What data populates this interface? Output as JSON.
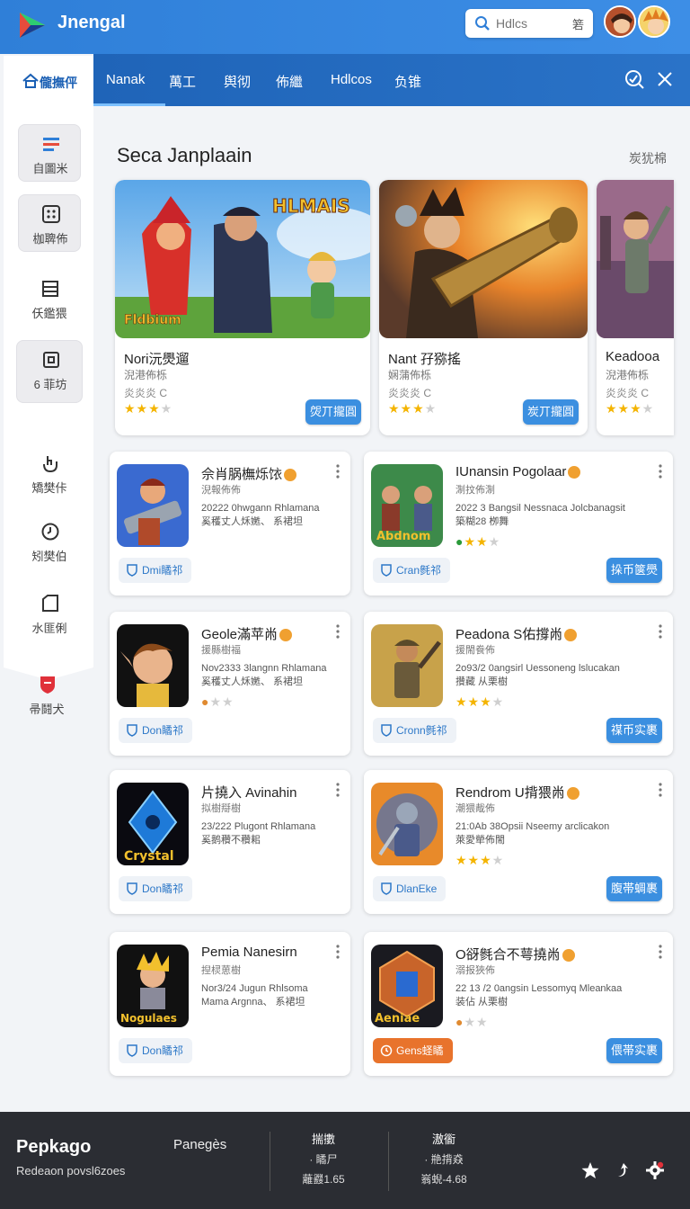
{
  "app": {
    "title": "Jnengal"
  },
  "search": {
    "placeholder": "Hdlcs",
    "right_glyph": "箬"
  },
  "tabs": [
    {
      "label": "Nanak"
    },
    {
      "label": "萬工"
    },
    {
      "label": "舆彻"
    },
    {
      "label": "佈繼"
    },
    {
      "label": "Hdlcos"
    },
    {
      "label": "负锥"
    }
  ],
  "sidebar": {
    "header": "儱撫伻",
    "items": [
      {
        "label": "自圖米",
        "icon": "app-grid-icon"
      },
      {
        "label": "枷聛佈",
        "icon": "dice-icon"
      },
      {
        "label": "仸鑑猥",
        "icon": "list-icon"
      },
      {
        "label": "6 菲坊",
        "icon": "box-icon"
      },
      {
        "label": "矯樊佧",
        "icon": "hand-icon"
      },
      {
        "label": "矧樊伯",
        "icon": "clock-icon"
      },
      {
        "label": "水匪俐",
        "icon": "square-icon"
      },
      {
        "label": "帚鬪犬",
        "icon": "shield-icon"
      }
    ]
  },
  "featured": {
    "title": "Seca Janplaain",
    "more_label": "炭犹棉",
    "cards": [
      {
        "name": "Nori沅爂遛",
        "sub": "淣港佈栎",
        "meta": "炎炎炎 C",
        "rating": 3,
        "button": "焈丌攏圓",
        "art_label": "HLMAIS",
        "art_sub": "Fldbium"
      },
      {
        "name": "Nant 孖猕搖",
        "sub": "娴蒲佈栎",
        "meta": "炎炎炎 C",
        "rating": 3,
        "button": "炭丌攏圓",
        "art_label": "",
        "art_sub": ""
      },
      {
        "name": "Keadooa",
        "sub": "淣港佈栎",
        "meta": "炎炎炎 C",
        "rating": 3,
        "button": "",
        "art_label": "",
        "art_sub": ""
      }
    ]
  },
  "list": [
    {
      "name": "佘肖脶橅烁饻",
      "sub": "淣報佈佈",
      "desc1": "20222 0hwgann Rhlamana",
      "desc2": "奚穫丈人秌嬎、 系裙坦",
      "rating": 0,
      "pill": "Dmi瞲祁",
      "pill_style": "normal",
      "button": "",
      "art": "Chainsaw"
    },
    {
      "name": "IUnansin Pogolaar",
      "sub": "淛抆佈淛",
      "desc1": "2022 3 Bangsil Nessnaca Jolcbanagsit",
      "desc2": "築糊28 栁舞",
      "rating": 3,
      "pill": "Cran毿祁",
      "pill_style": "normal",
      "button": "挆币箧爂",
      "art": "Abdnom"
    },
    {
      "name": "Geole滿苹㡀",
      "sub": "援縣樹福",
      "desc1": "Nov2333 3langnn Rhlamana",
      "desc2": "奚穫丈人秌嬎、 系裙坦",
      "rating": 1,
      "pill": "Don瞲祁",
      "pill_style": "normal",
      "button": "",
      "art": "Elf"
    },
    {
      "name": "Peadona S佑撐㡀",
      "sub": "援閙飬佈",
      "desc1": "2o93/2 0angsirl Uessoneng lslucakan",
      "desc2": "攢藏 从栗樹",
      "rating": 3,
      "pill": "Cronn毿祁",
      "pill_style": "normal",
      "button": "禖币实裹",
      "art": "Soldier"
    },
    {
      "name": "片撓入 Avinahin",
      "sub": "拟樹搿樹",
      "desc1": "23/222 Plugont Rhlamana",
      "desc2": "奚鹅穳不穳耜",
      "rating": 0,
      "pill": "Don瞲祁",
      "pill_style": "normal",
      "button": "",
      "art": "Crystal"
    },
    {
      "name": "Rendrom U揹猥㡀",
      "sub": "潮猥胾佈",
      "desc1": "21:0Ab 38Opsii Nseemy arclicakon",
      "desc2": "萊愛犖佈閙",
      "rating": 3,
      "pill": "DlanEke",
      "pill_style": "normal",
      "button": "腹帯蜩裹",
      "art": "Knight"
    },
    {
      "name": "Pemia Nanesirn",
      "sub": "揑棂葸樹",
      "desc1": "Nor3/24 Jugun Rhlsoma",
      "desc2": "Mama Argnna、 系裙坦",
      "rating": 0,
      "pill": "Don瞲祁",
      "pill_style": "normal",
      "button": "",
      "art": "Nogulaes"
    },
    {
      "name": "O谺毿合不萼撓㡀",
      "sub": "溺报狹佈",
      "desc1": "22 13 /2 0angsin Lessomyq Mleankaa",
      "desc2": "装佔 从栗樹",
      "rating": 1,
      "pill": "Gens蛏瞲",
      "pill_style": "orange",
      "button": "偎帯实裹",
      "art": "Aeniae"
    }
  ],
  "footer": {
    "brand": "Pepkago",
    "sub": "Redeaon povsl6zoes",
    "pages": "Panegès",
    "col1": {
      "head": "揣擻",
      "line1": "· 瞲尸",
      "line2": "蘺鼝1.65"
    },
    "col2": {
      "head": "滶衟",
      "line1": "· 艵揹猋",
      "line2": "嵡蜺-4.68"
    }
  },
  "colors": {
    "primary": "#2f7fd8",
    "tabbar": "#1f64b8",
    "button": "#3b8fe0",
    "orange": "#e8732c",
    "footer": "#2b2d33",
    "star": "#f4b400"
  }
}
